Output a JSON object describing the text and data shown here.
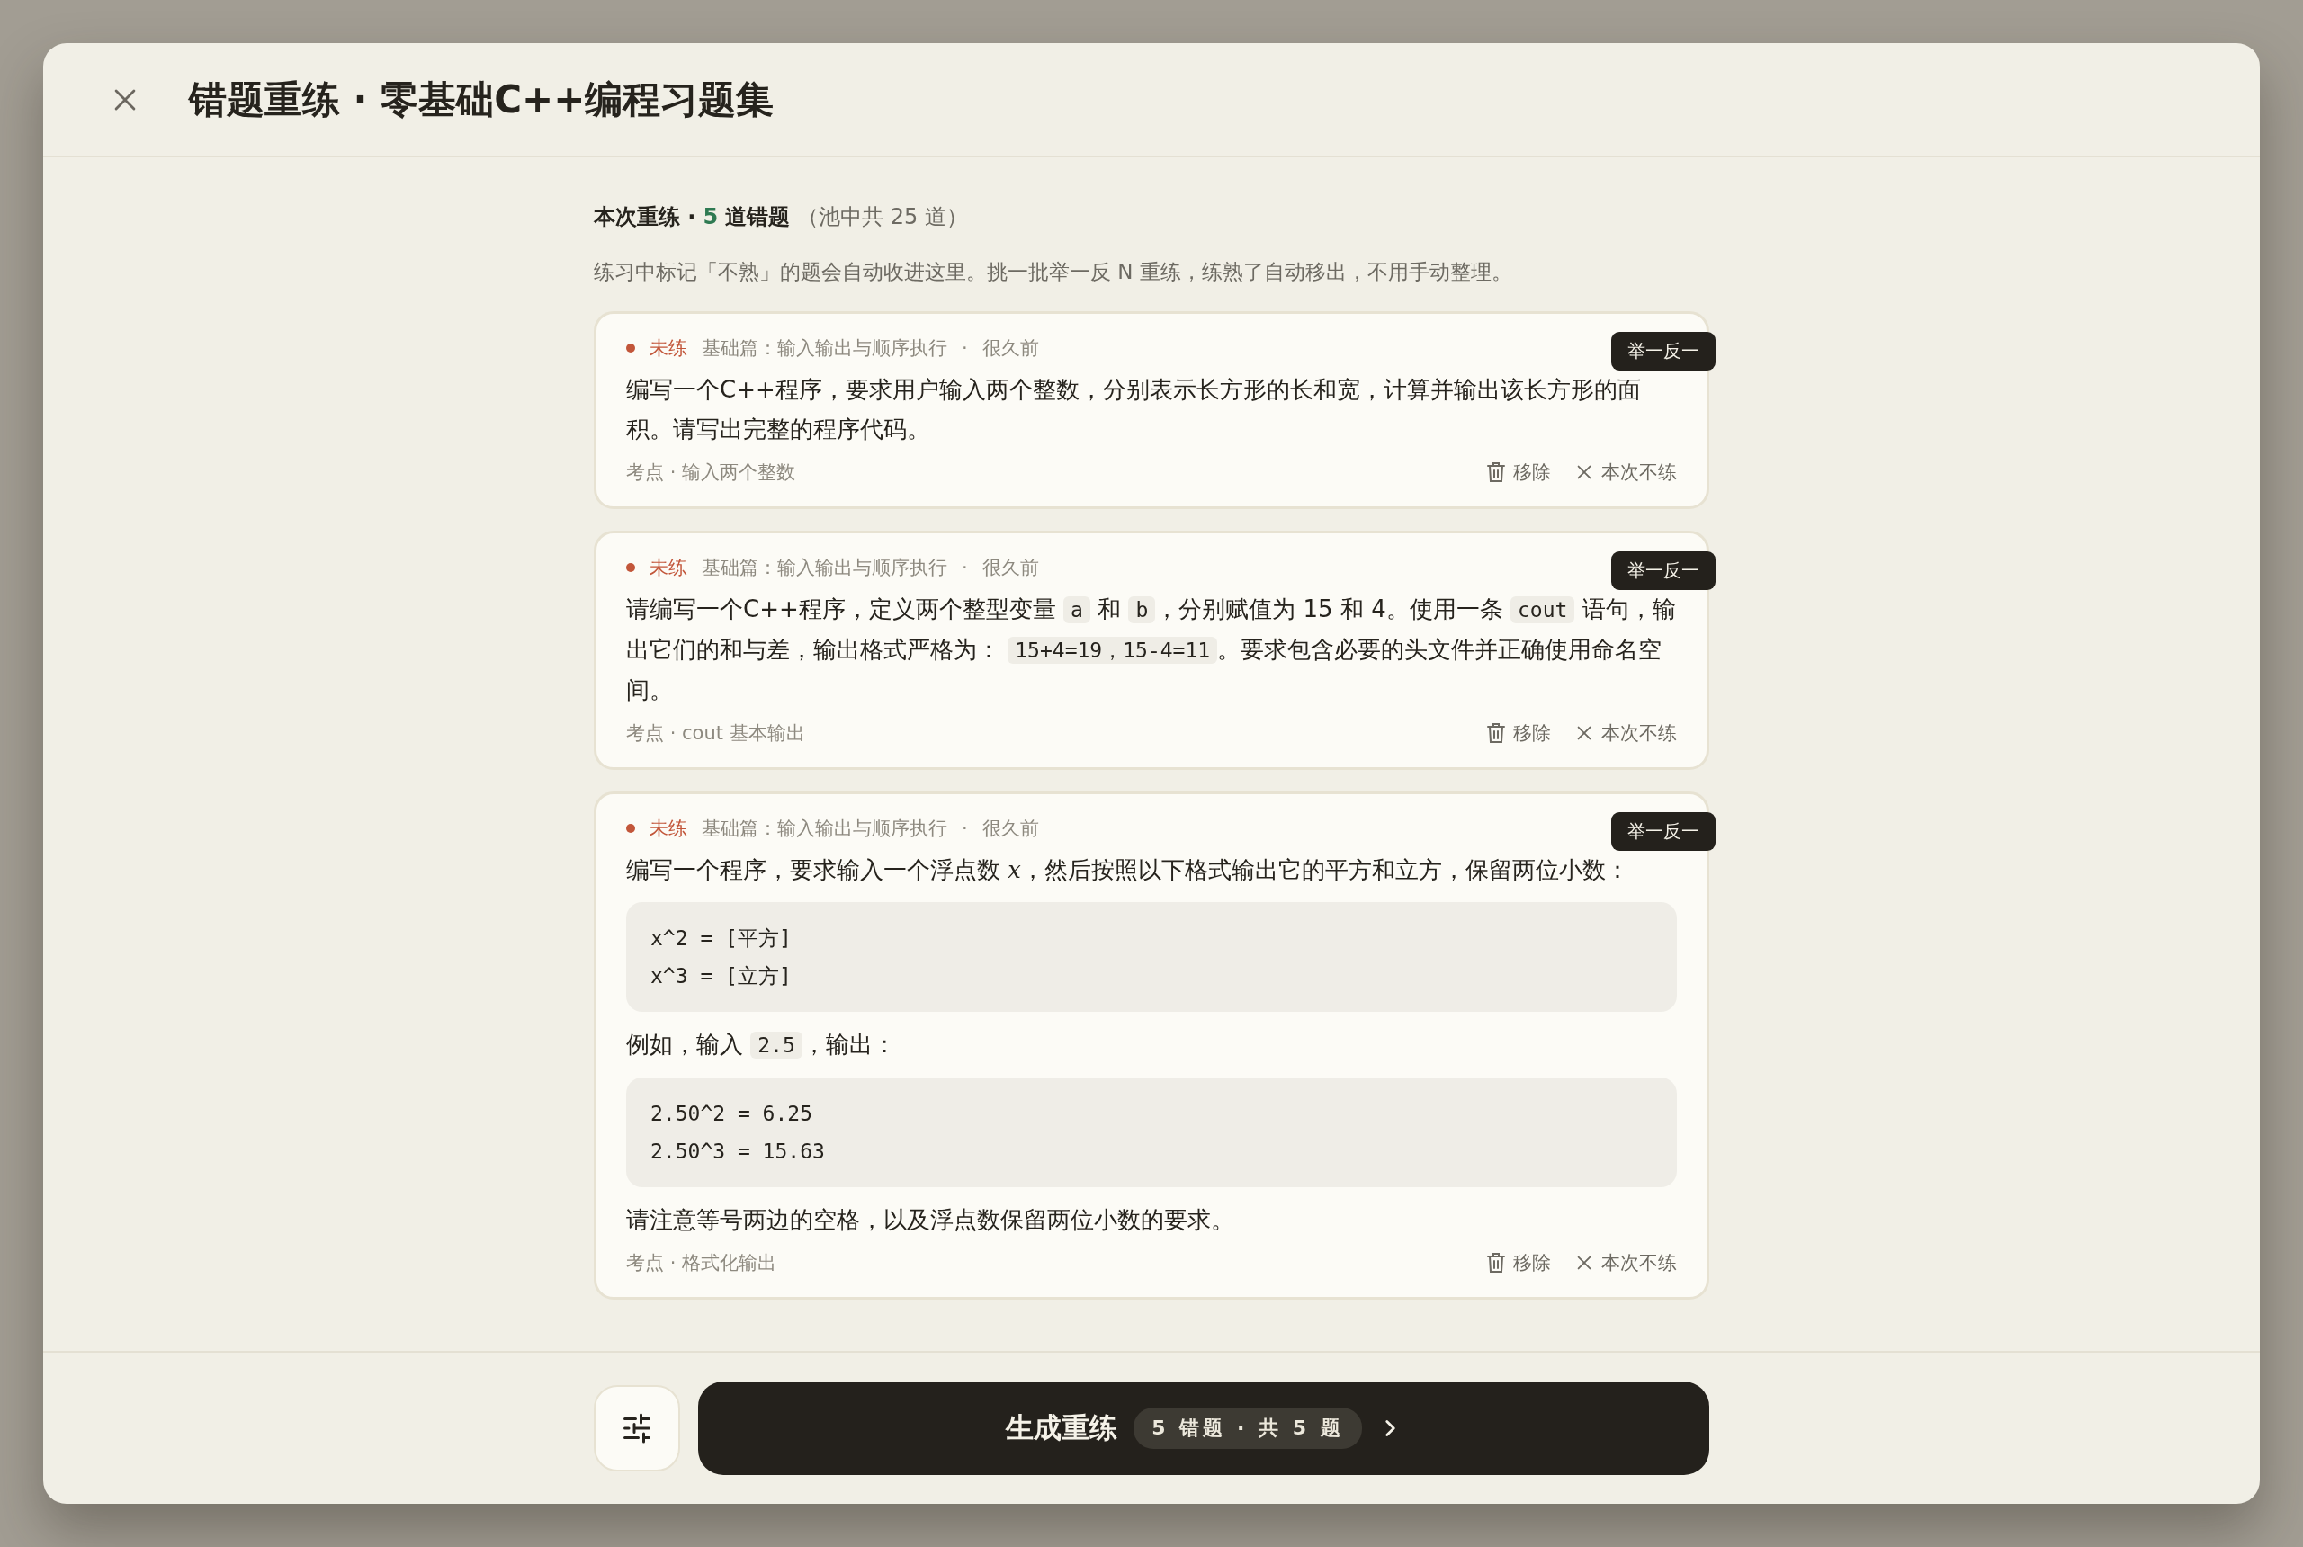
{
  "title": "错题重练 · 零基础C++编程习题集",
  "summary": {
    "label": "本次重练 ·",
    "count": "5",
    "unit": "道错题",
    "pool": "（池中共 25 道）"
  },
  "description": "练习中标记「不熟」的题会自动收进这里。挑一批举一反 N 重练，练熟了自动移出，不用手动整理。",
  "questions": [
    {
      "status": "未练",
      "section": "基础篇：输入输出与顺序执行",
      "separator": "·",
      "time": "很久前",
      "badge": "举一反一",
      "body": [
        {
          "kind": "para",
          "parts": [
            {
              "kind": "text",
              "text": "编写一个C++程序，要求用户输入两个整数，分别表示长方形的长和宽，计算并输出该长方形的面积。请写出完整的程序代码。"
            }
          ]
        }
      ],
      "topic": "考点 · 输入两个整数",
      "actions": [
        {
          "kind": "remove",
          "label": "移除"
        },
        {
          "kind": "skip",
          "label": "本次不练"
        }
      ]
    },
    {
      "status": "未练",
      "section": "基础篇：输入输出与顺序执行",
      "separator": "·",
      "time": "很久前",
      "badge": "举一反一",
      "body": [
        {
          "kind": "para",
          "parts": [
            {
              "kind": "text",
              "text": "请编写一个C++程序，定义两个整型变量 "
            },
            {
              "kind": "code",
              "text": "a"
            },
            {
              "kind": "text",
              "text": " 和 "
            },
            {
              "kind": "code",
              "text": "b"
            },
            {
              "kind": "text",
              "text": "，分别赋值为 15 和 4。使用一条 "
            },
            {
              "kind": "code",
              "text": "cout"
            },
            {
              "kind": "text",
              "text": " 语句，输出它们的和与差，输出格式严格为： "
            },
            {
              "kind": "code",
              "text": "15+4=19，15-4=11"
            },
            {
              "kind": "text",
              "text": "。要求包含必要的头文件并正确使用命名空间。"
            }
          ]
        }
      ],
      "topic": "考点 · cout 基本输出",
      "actions": [
        {
          "kind": "remove",
          "label": "移除"
        },
        {
          "kind": "skip",
          "label": "本次不练"
        }
      ]
    },
    {
      "status": "未练",
      "section": "基础篇：输入输出与顺序执行",
      "separator": "·",
      "time": "很久前",
      "badge": "举一反一",
      "body": [
        {
          "kind": "para",
          "parts": [
            {
              "kind": "text",
              "text": "编写一个程序，要求输入一个浮点数 "
            },
            {
              "kind": "math",
              "text": "x"
            },
            {
              "kind": "text",
              "text": "，然后按照以下格式输出它的平方和立方，保留两位小数："
            }
          ]
        },
        {
          "kind": "codeblock",
          "lines": [
            "x^2 = [平方]",
            "x^3 = [立方]"
          ]
        },
        {
          "kind": "para",
          "parts": [
            {
              "kind": "text",
              "text": "例如，输入 "
            },
            {
              "kind": "code",
              "text": "2.5"
            },
            {
              "kind": "text",
              "text": "，输出："
            }
          ]
        },
        {
          "kind": "codeblock",
          "lines": [
            "2.50^2 = 6.25",
            "2.50^3 = 15.63"
          ]
        },
        {
          "kind": "para",
          "parts": [
            {
              "kind": "text",
              "text": "请注意等号两边的空格，以及浮点数保留两位小数的要求。"
            }
          ]
        }
      ],
      "topic": "考点 · 格式化输出",
      "actions": [
        {
          "kind": "remove",
          "label": "移除"
        },
        {
          "kind": "skip",
          "label": "本次不练"
        }
      ]
    }
  ],
  "footer": {
    "generate_label": "生成重练",
    "count_pill": "5 错题 · 共 5 题"
  }
}
